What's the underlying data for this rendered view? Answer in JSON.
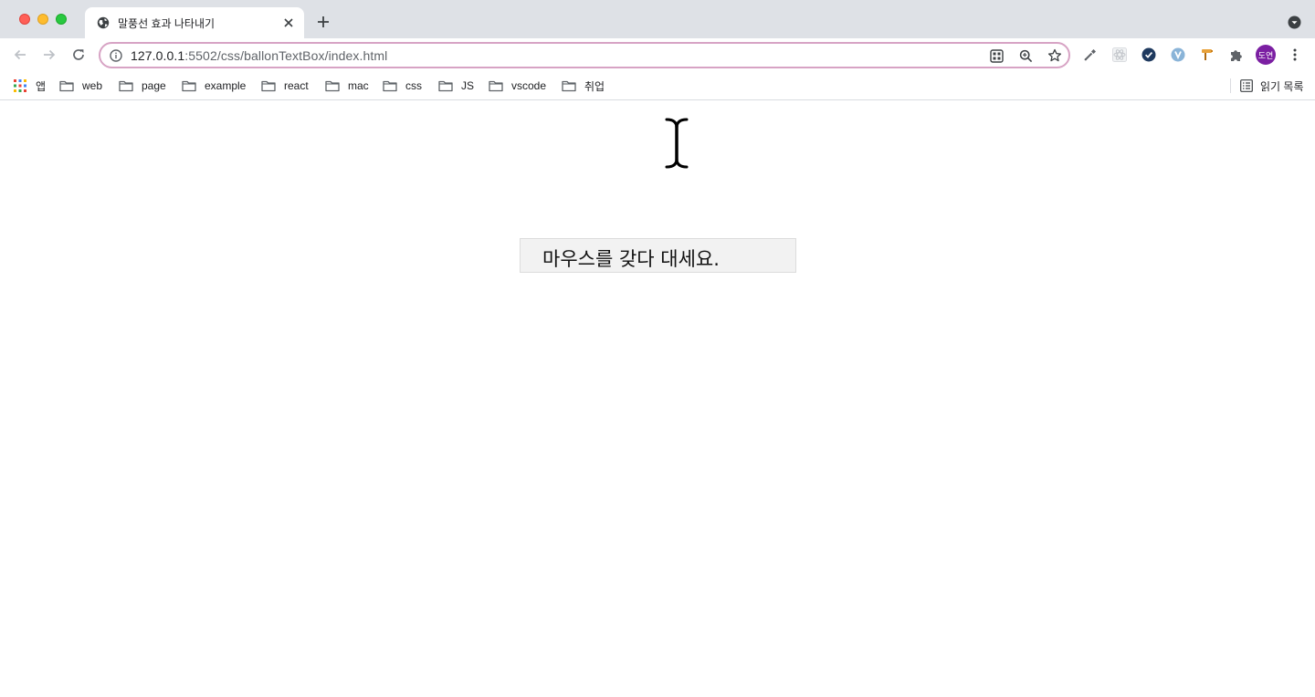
{
  "tab": {
    "title": "말풍선 효과 나타내기",
    "favicon": "globe-icon"
  },
  "address_bar": {
    "host": "127.0.0.1",
    "path": ":5502/css/ballonTextBox/index.html"
  },
  "profile": {
    "initials": "도연"
  },
  "bookmarks": {
    "apps_label": "앱",
    "items": [
      {
        "label": "web"
      },
      {
        "label": "page"
      },
      {
        "label": "example"
      },
      {
        "label": "react"
      },
      {
        "label": "mac"
      },
      {
        "label": "css"
      },
      {
        "label": "JS"
      },
      {
        "label": "vscode"
      },
      {
        "label": "취업"
      }
    ],
    "reading_list_label": "읽기 목록"
  },
  "page": {
    "hover_text": "마우스를 갖다 대세요."
  },
  "colors": {
    "tabstrip_bg": "#dee1e6",
    "omnibox_border": "#d7a3c4",
    "avatar_bg": "#7b1fa2",
    "hover_box_bg": "#f2f2f2"
  }
}
